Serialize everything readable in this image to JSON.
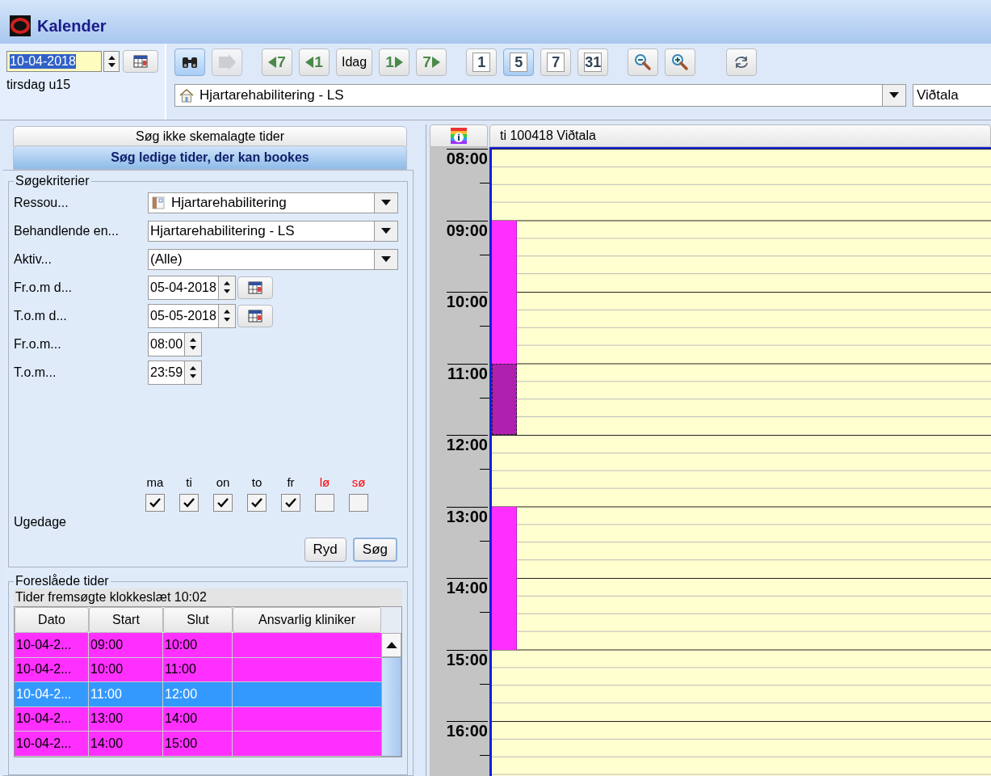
{
  "window": {
    "title": "Kalender"
  },
  "date_picker": {
    "value": "10-04-2018",
    "weekday": "tirsdag u15"
  },
  "search_buttons": [
    {
      "kind": "binoculars",
      "selected": true,
      "disabled": false
    },
    {
      "kind": "goto",
      "selected": false,
      "disabled": true
    }
  ],
  "nav_buttons": [
    {
      "kind": "back",
      "label": "7"
    },
    {
      "kind": "back",
      "label": "1"
    },
    {
      "kind": "text",
      "label": "Idag"
    },
    {
      "kind": "forward",
      "label": "1"
    },
    {
      "kind": "forward",
      "label": "7"
    }
  ],
  "view_buttons": [
    {
      "label": "1",
      "selected": false
    },
    {
      "label": "5",
      "selected": true
    },
    {
      "label": "7",
      "selected": false
    },
    {
      "label": "31",
      "selected": false
    }
  ],
  "zoom_buttons": [
    {
      "kind": "zoom-out"
    },
    {
      "kind": "zoom-in"
    }
  ],
  "location": {
    "value": "Hjartarehabilitering - LS"
  },
  "type_field": {
    "value": "Viðtala"
  },
  "tabs": [
    {
      "label": "Søg ikke skemalagte tider",
      "selected": false
    },
    {
      "label": "Søg ledige tider, der kan bookes",
      "selected": true
    }
  ],
  "criteria": {
    "title": "Søgekriterier",
    "fields": [
      {
        "kind": "resource",
        "label": "Ressou...",
        "value": "Hjartarehabilitering"
      },
      {
        "kind": "dropdown",
        "label": "Behandlende en...",
        "value": "Hjartarehabilitering - LS"
      },
      {
        "kind": "dropdown",
        "label": "Aktiv...",
        "value": "(Alle)"
      },
      {
        "kind": "date",
        "label": "Fr.o.m d...",
        "value": "05-04-2018"
      },
      {
        "kind": "date",
        "label": "T.o.m d...",
        "value": "05-05-2018"
      },
      {
        "kind": "time",
        "label": "Fr.o.m...",
        "value": "08:00"
      },
      {
        "kind": "time",
        "label": "T.o.m...",
        "value": "23:59"
      }
    ],
    "weekdays_label": "Ugedage",
    "weekdays": [
      {
        "label": "ma",
        "checked": true,
        "color": "#000000"
      },
      {
        "label": "ti",
        "checked": true,
        "color": "#000000"
      },
      {
        "label": "on",
        "checked": true,
        "color": "#000000"
      },
      {
        "label": "to",
        "checked": true,
        "color": "#000000"
      },
      {
        "label": "fr",
        "checked": true,
        "color": "#000000"
      },
      {
        "label": "lø",
        "checked": false,
        "color": "#ff0000"
      },
      {
        "label": "sø",
        "checked": false,
        "color": "#ff0000"
      }
    ],
    "buttons": [
      {
        "label": "Ryd",
        "default": false
      },
      {
        "label": "Søg",
        "default": true
      }
    ]
  },
  "results": {
    "title": "Foreslåede tider",
    "caption": "Tider fremsøgte klokkeslæt 10:02",
    "columns": [
      "Dato",
      "Start",
      "Slut",
      "Ansvarlig kliniker"
    ],
    "rows": [
      {
        "cells": [
          "10-04-2...",
          "09:00",
          "10:00"
        ],
        "selected": false
      },
      {
        "cells": [
          "10-04-2...",
          "10:00",
          "11:00"
        ],
        "selected": false
      },
      {
        "cells": [
          "10-04-2...",
          "11:00",
          "12:00"
        ],
        "selected": true
      },
      {
        "cells": [
          "10-04-2...",
          "13:00",
          "14:00"
        ],
        "selected": false
      },
      {
        "cells": [
          "10-04-2...",
          "14:00",
          "15:00"
        ],
        "selected": false
      }
    ]
  },
  "calendar": {
    "header": "ti 100418 Viðtala",
    "hours": [
      "08:00",
      "09:00",
      "10:00",
      "11:00",
      "12:00",
      "13:00",
      "14:00",
      "15:00",
      "16:00"
    ]
  }
}
